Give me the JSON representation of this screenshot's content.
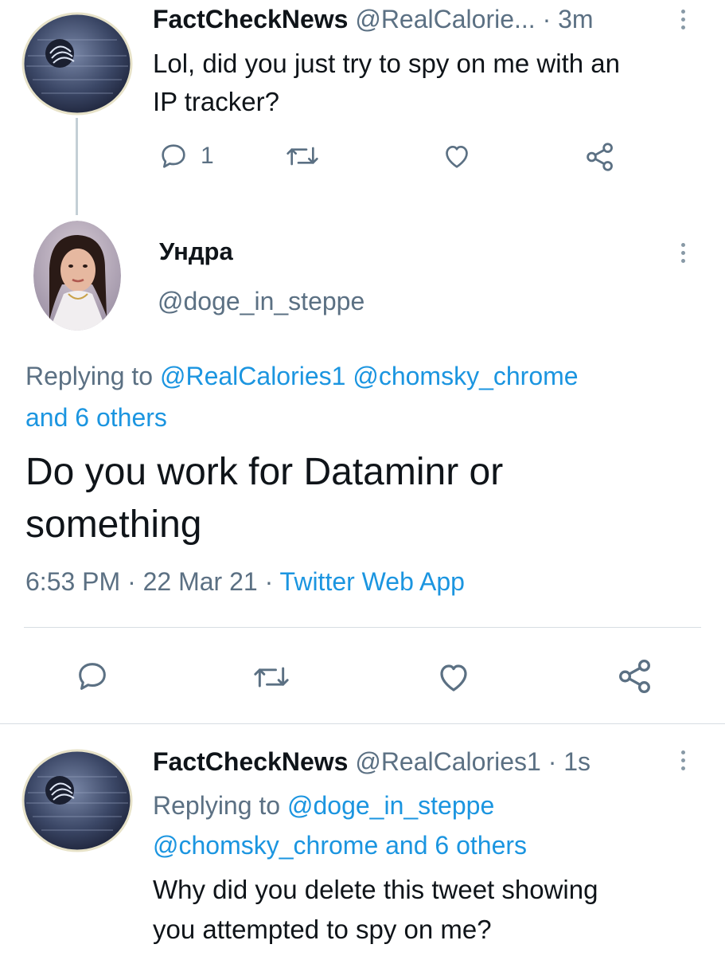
{
  "tweet1": {
    "display_name": "FactCheckNews",
    "handle": "@RealCalorie...",
    "time": "· 3m",
    "text_line1": "Lol, did you just try to spy on me with an",
    "text_line2": "IP tracker?",
    "reply_count": "1"
  },
  "main_tweet": {
    "display_name": "Ундра",
    "handle": "@doge_in_steppe",
    "replying_prefix": "Replying to",
    "replying_mention1": "@RealCalories1",
    "replying_mention2": "@chomsky_chrome",
    "replying_others": "and 6 others",
    "text_line1": "Do you work for Dataminr or",
    "text_line2": "something",
    "time": "6:53 PM",
    "date": "22 Mar 21",
    "source": "Twitter Web App",
    "separator": "·"
  },
  "tweet3": {
    "display_name": "FactCheckNews",
    "handle": "@RealCalories1",
    "time": "· 1s",
    "replying_prefix": "Replying to",
    "replying_mention1": "@doge_in_steppe",
    "replying_line2": "@chomsky_chrome and 6 others",
    "text_line1": "Why did you delete this tweet showing",
    "text_line2": "you attempted to spy on me?"
  },
  "icons": [
    "reply-icon",
    "retweet-icon",
    "like-icon",
    "share-icon",
    "more-icon"
  ],
  "colors": {
    "link": "#1b95e0",
    "muted": "#5b7083",
    "text": "#0f1419",
    "icon": "#5b7083"
  }
}
